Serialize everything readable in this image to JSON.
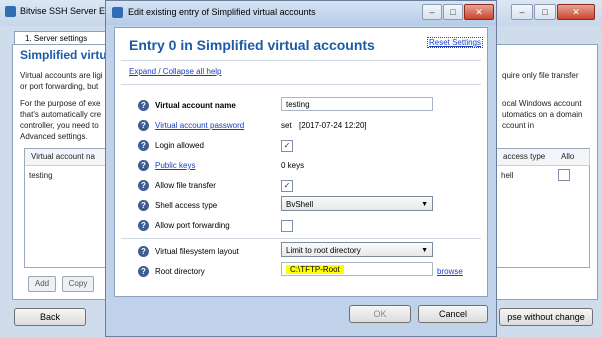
{
  "background_window": {
    "title": "Bitvise SSH Server Ea",
    "tab": "1. Server settings",
    "heading": "Simplified virtu",
    "left_text_lines": [
      "Virtual accounts are ligi",
      "or port forwarding, but",
      "",
      "For the purpose of exe",
      "that's automatically cre",
      "controller, you need to",
      "Advanced settings."
    ],
    "right_text_lines": [
      "quire only file transfer",
      "",
      "",
      "ocal Windows account",
      "utomatics on a domain",
      "ccount in",
      ""
    ],
    "table": {
      "columns_left": [
        "Virtual account na"
      ],
      "columns_right": [
        "access type",
        "Allo"
      ],
      "rows": [
        {
          "name": "testing",
          "access": "hell"
        }
      ]
    },
    "buttons": {
      "add": "Add",
      "copy": "Copy",
      "back": "Back",
      "close_without_change": "pse without change"
    }
  },
  "dialog": {
    "title": "Edit existing entry of Simplified virtual accounts",
    "entry_title": "Entry 0 in Simplified virtual accounts",
    "reset_link": "Reset Settings",
    "expand_link": "Expand / Collapse all help",
    "fields": {
      "account_name": {
        "label": "Virtual account name",
        "value": "testing"
      },
      "password": {
        "label": "Virtual account password",
        "prefix": "set",
        "value": "[2017-07-24 12:20]"
      },
      "login_allowed": {
        "label": "Login allowed",
        "checked": "✓"
      },
      "public_keys": {
        "label": "Public keys",
        "value": "0 keys"
      },
      "file_transfer": {
        "label": "Allow file transfer",
        "checked": "✓"
      },
      "shell_access": {
        "label": "Shell access type",
        "value": "BvShell"
      },
      "port_forwarding": {
        "label": "Allow port forwarding",
        "checked": ""
      },
      "vfs_layout": {
        "label": "Virtual filesystem layout",
        "value": "Limit to root directory"
      },
      "root_directory": {
        "label": "Root directory",
        "value": "C:\\TFTP-Root",
        "browse": "browse"
      }
    },
    "buttons": {
      "ok": "OK",
      "cancel": "Cancel"
    },
    "help_glyph": "?"
  },
  "titlebar_glyphs": {
    "minimize": "–",
    "maximize": "□",
    "close": "✕"
  },
  "colors": {
    "accent": "#1c5aa8",
    "link": "#1a3ec2",
    "highlight": "#ffff00"
  },
  "icons": [
    "bitvise-app-icon",
    "help-icon",
    "checkbox-icon",
    "dropdown-arrow-icon"
  ]
}
